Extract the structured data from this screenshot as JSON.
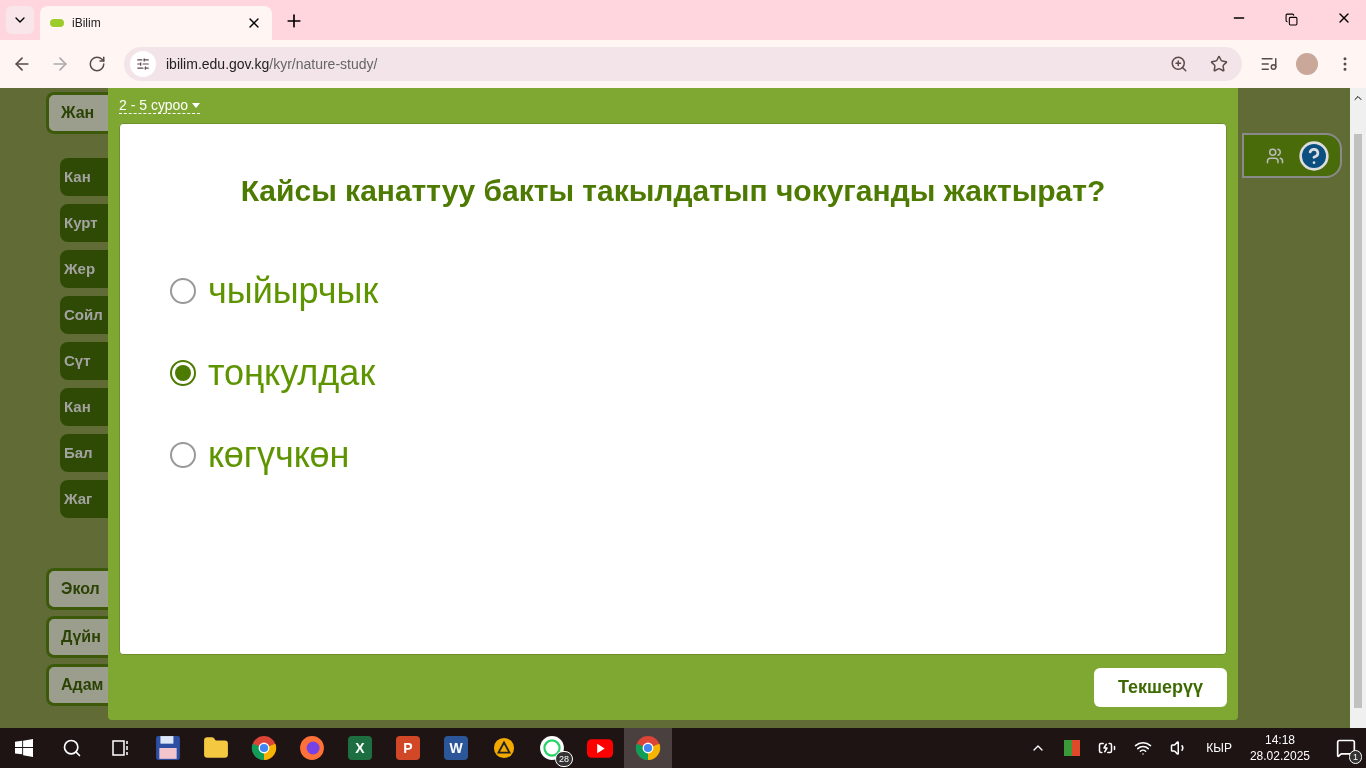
{
  "browser": {
    "tab_title": "iBilim",
    "url_host": "ibilim.edu.gov.kg",
    "url_path": "/kyr/nature-study/"
  },
  "sidebar": {
    "items": [
      {
        "label": "Жан",
        "children": [
          {
            "label": "Кан"
          },
          {
            "label": "Курт"
          },
          {
            "label": "Жер"
          },
          {
            "label": "Сойл"
          },
          {
            "label": "Сүт"
          },
          {
            "label": "Кан"
          },
          {
            "label": "Бал"
          },
          {
            "label": "Жаг"
          }
        ]
      },
      {
        "label": "Экол"
      },
      {
        "label": "Дүйн"
      },
      {
        "label": "Адам"
      }
    ]
  },
  "quiz": {
    "progress_label": "2 - 5 суроо",
    "question": "Кайсы канаттуу бакты такылдатып чокуганды жактырат?",
    "options": [
      {
        "label": "чыйырчык",
        "selected": false
      },
      {
        "label": "тоңкулдак",
        "selected": true
      },
      {
        "label": "көгүчкөн",
        "selected": false
      }
    ],
    "check_button": "Текшерүү"
  },
  "taskbar": {
    "apps": [
      {
        "kind": "start",
        "selected": false
      },
      {
        "kind": "search",
        "selected": false
      },
      {
        "kind": "taskview",
        "selected": false
      },
      {
        "kind": "floppy",
        "selected": false
      },
      {
        "kind": "folder",
        "selected": false
      },
      {
        "kind": "chrome",
        "selected": false
      },
      {
        "kind": "firefox",
        "selected": false
      },
      {
        "kind": "excel",
        "glyph": "X",
        "selected": false
      },
      {
        "kind": "powerpoint",
        "glyph": "P",
        "selected": false
      },
      {
        "kind": "word",
        "glyph": "W",
        "selected": false
      },
      {
        "kind": "triangle",
        "selected": false
      },
      {
        "kind": "whatsapp",
        "badge": "28",
        "selected": false
      },
      {
        "kind": "youtube",
        "selected": false
      },
      {
        "kind": "chrome",
        "selected": true
      }
    ],
    "language": "КЫР",
    "time": "14:18",
    "date": "28.02.2025",
    "notifications": "1"
  }
}
